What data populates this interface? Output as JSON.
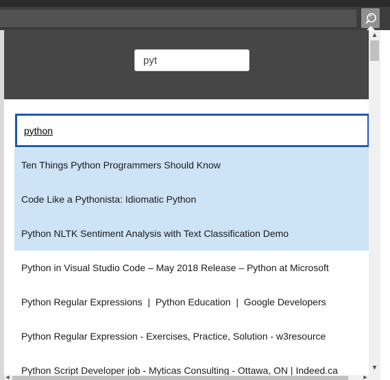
{
  "browser": {
    "extension_icon": "magnifier-icon",
    "colors": {
      "toolbar": "#3d3d3d",
      "popup_header": "#464646",
      "highlight": "#cde3f6",
      "focus_border": "#1f56b5"
    }
  },
  "popup": {
    "search": {
      "value": "pyt"
    },
    "query": "python",
    "results": [
      {
        "label": "Ten Things Python Programmers Should Know",
        "highlighted": true
      },
      {
        "label": "Code Like a Pythonista: Idiomatic Python",
        "highlighted": true
      },
      {
        "label": "Python NLTK Sentiment Analysis with Text Classification Demo",
        "highlighted": true
      },
      {
        "label": "Python in Visual Studio Code – May 2018 Release – Python at Microsoft",
        "highlighted": false
      },
      {
        "label": "Python Regular Expressions  |  Python Education  |  Google Developers",
        "highlighted": false
      },
      {
        "label": "Python Regular Expression - Exercises, Practice, Solution - w3resource",
        "highlighted": false
      },
      {
        "label": "Python Script Developer job - Myticas Consulting - Ottawa, ON | Indeed.ca",
        "highlighted": false
      }
    ]
  }
}
